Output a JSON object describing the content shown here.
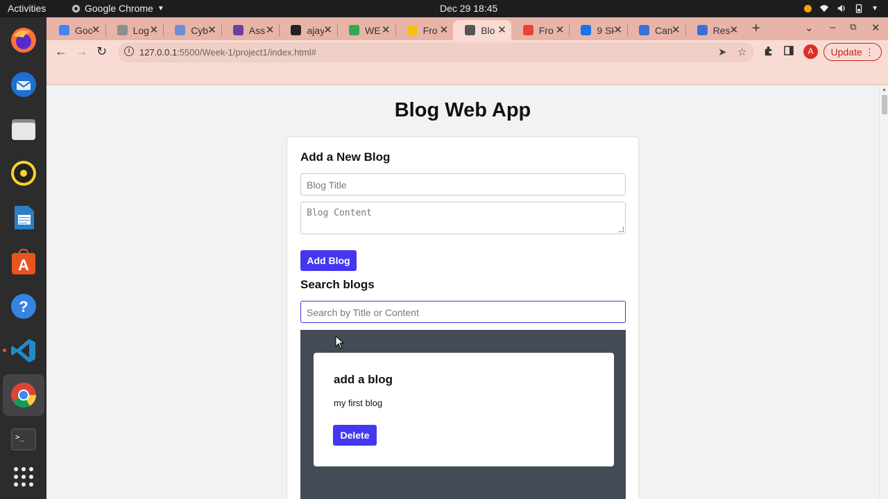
{
  "topbar": {
    "activities": "Activities",
    "app_name": "Google Chrome",
    "clock": "Dec 29  18:45"
  },
  "tabs": [
    {
      "title": "Goo",
      "color": "#4285f4"
    },
    {
      "title": "Log",
      "color": "#8e8e8e"
    },
    {
      "title": "Cyb",
      "color": "#6a8fd4"
    },
    {
      "title": "Ass",
      "color": "#6b3fa0"
    },
    {
      "title": "ajay",
      "color": "#222222"
    },
    {
      "title": "WE",
      "color": "#34a853"
    },
    {
      "title": "Fro",
      "color": "#f4c20d"
    },
    {
      "title": "Blo",
      "color": "#555555",
      "active": true
    },
    {
      "title": "Fro",
      "color": "#ea4335"
    },
    {
      "title": "9 Sk",
      "color": "#1a73e8"
    },
    {
      "title": "Can",
      "color": "#3d6fd9"
    },
    {
      "title": "Res",
      "color": "#3d6fd9"
    }
  ],
  "toolbar": {
    "url_host": "127.0.0.1",
    "url_path": ":5500/Week-1/project1/index.html#",
    "avatar_letter": "A",
    "update_label": "Update"
  },
  "page": {
    "title": "Blog Web App",
    "add_heading": "Add a New Blog",
    "title_placeholder": "Blog Title",
    "content_placeholder": "Blog Content",
    "add_button": "Add Blog",
    "search_heading": "Search blogs",
    "search_placeholder": "Search by Title or Content"
  },
  "posts": [
    {
      "title": "add a blog",
      "content": "my first blog",
      "delete_label": "Delete"
    }
  ],
  "colors": {
    "accent": "#4338f0",
    "list_bg": "#434b57",
    "tabstrip": "#e8b4a8",
    "toolbar": "#f8dcd4"
  }
}
